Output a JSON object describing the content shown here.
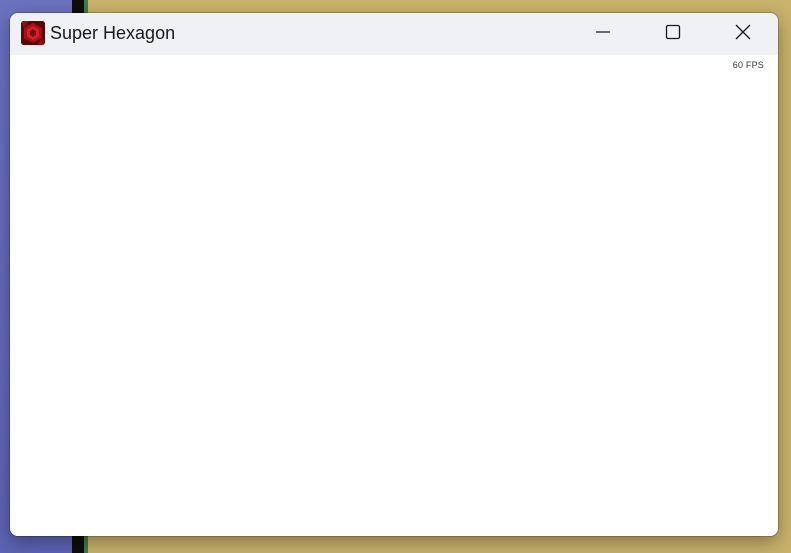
{
  "window": {
    "title": "Super Hexagon",
    "icon": "super-hexagon-app-icon",
    "controls": {
      "minimize_icon": "minimize-icon",
      "maximize_icon": "maximize-icon",
      "close_icon": "close-icon"
    }
  },
  "game": {
    "fps_label": "60 FPS"
  },
  "colors": {
    "titlebar": "#eff1f4",
    "content_background": "#ffffff",
    "icon_red": "#c4141c",
    "desktop_left": "#6b72c0",
    "desktop_right": "#c8b26c"
  }
}
